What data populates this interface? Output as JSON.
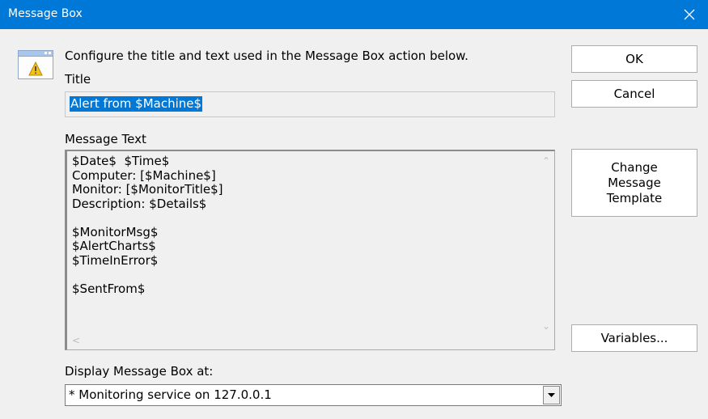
{
  "window": {
    "title": "Message Box"
  },
  "intro": "Configure the title and text used in the Message Box action below.",
  "title_section": {
    "label": "Title",
    "value": "Alert from $Machine$"
  },
  "message_section": {
    "label": "Message Text",
    "lines": [
      "$Date$  $Time$",
      "Computer: [$Machine$]",
      "Monitor: [$MonitorTitle$]",
      "Description: $Details$",
      "",
      "$MonitorMsg$",
      "$AlertCharts$",
      "$TimeInError$",
      "",
      "$SentFrom$"
    ]
  },
  "buttons": {
    "ok": "OK",
    "cancel": "Cancel",
    "change_template": [
      "Change",
      "Message",
      "Template"
    ],
    "variables": "Variables..."
  },
  "display_at": {
    "label": "Display Message Box at:",
    "selected": "* Monitoring service on 127.0.0.1"
  },
  "icons": {
    "window_close": "close-icon",
    "warning": "warning-icon",
    "dropdown": "chevron-down-icon"
  },
  "colors": {
    "titlebar": "#0078d7",
    "selection": "#0078d7"
  }
}
